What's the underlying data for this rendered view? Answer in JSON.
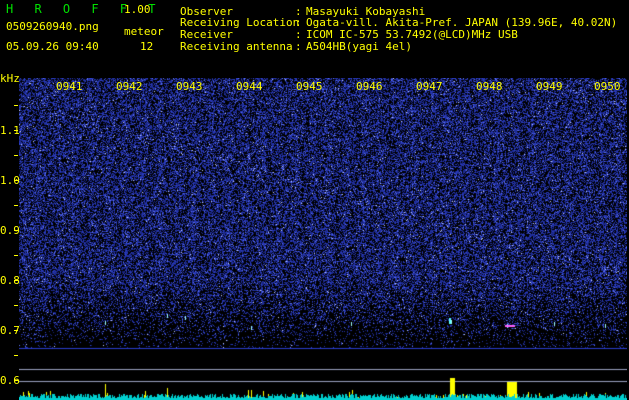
{
  "header": {
    "app_title": "H R O F F T",
    "version": "1.00",
    "filename": "0509260940.png",
    "datetime": "05.09.26 09:40",
    "meteor_label": "meteor",
    "meteor_count": "12"
  },
  "info": [
    {
      "label": "Observer",
      "value": "Masayuki Kobayashi"
    },
    {
      "label": "Receiving Location",
      "value": "Ogata-vill. Akita-Pref. JAPAN (139.96E, 40.02N)"
    },
    {
      "label": "Receiver",
      "value": "ICOM IC-575 53.7492(@LCD)MHz USB"
    },
    {
      "label": "Receiving antenna",
      "value": "A504HB(yagi 4el)"
    }
  ],
  "axis": {
    "unit": "kHz",
    "freq_ticks": [
      "1.1",
      "1.0",
      "0.9",
      "0.8",
      "0.7",
      "0.6"
    ],
    "time_ticks": [
      "0941",
      "0942",
      "0943",
      "0944",
      "0945",
      "0946",
      "0947",
      "0948",
      "0949",
      "0950"
    ]
  },
  "colors": {
    "background": "#000000",
    "text": "#ffff00",
    "title": "#00e000",
    "spectrogram_noise": "#2030c0",
    "baseline": "#00d0d0"
  }
}
